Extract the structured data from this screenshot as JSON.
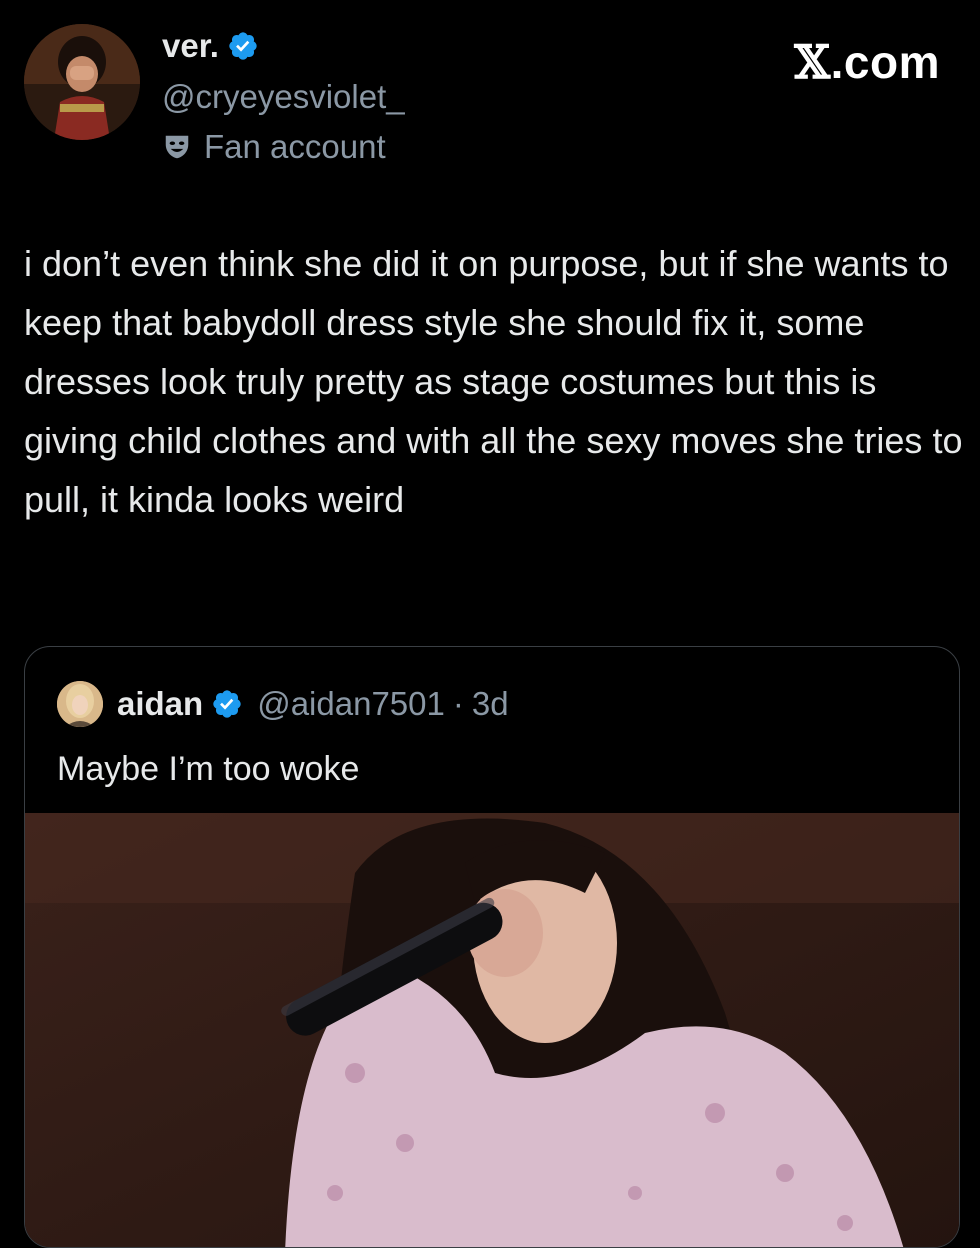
{
  "brand": {
    "logo_letter": "𝕏",
    "logo_suffix": ".com"
  },
  "author": {
    "display_name": "ver.",
    "handle": "@cryeyesviolet_",
    "badge_label": "Fan account",
    "badge_icon": "theater-mask-icon",
    "verified_icon": "verified-badge-icon"
  },
  "tweet": {
    "text": "i don’t even think she did it on purpose, but if she wants to keep that babydoll dress style she should fix it, some dresses look truly pretty as stage costumes but this is giving child clothes and with all the sexy moves she tries to pull, it kinda looks weird"
  },
  "quoted_tweet": {
    "display_name": "aidan",
    "handle": "@aidan7501",
    "separator": "·",
    "time": "3d",
    "text": "Maybe I’m too woke",
    "media_icon": "photo-icon"
  },
  "colors": {
    "background": "#000000",
    "text_primary": "#e7e9ea",
    "text_secondary": "#8b98a5",
    "verified_blue": "#1d9bf0",
    "border": "#3a3f44"
  }
}
